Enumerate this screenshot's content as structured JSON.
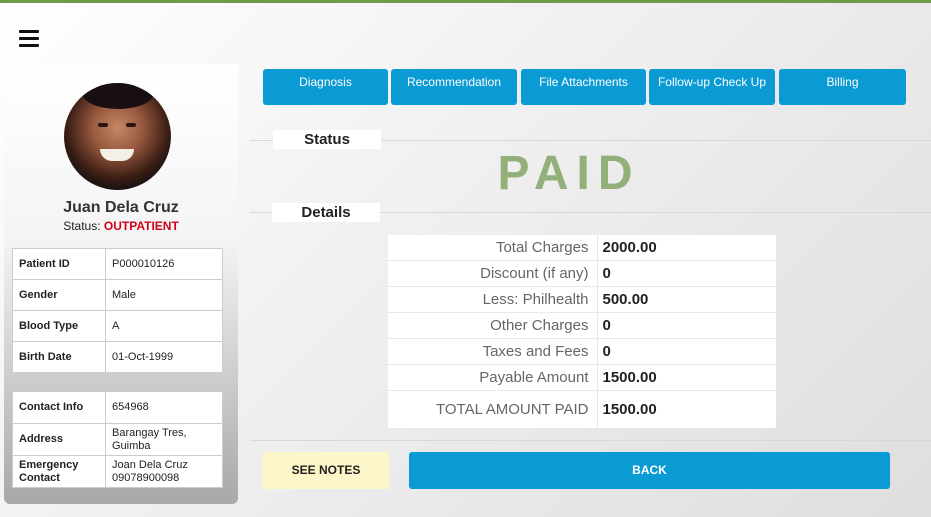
{
  "patient": {
    "name": "Juan Dela Cruz",
    "status_label": "Status:",
    "status_value": "OUTPATIENT"
  },
  "info": [
    {
      "label": "Patient ID",
      "value": "P000010126"
    },
    {
      "label": "Gender",
      "value": "Male"
    },
    {
      "label": "Blood Type",
      "value": "A"
    },
    {
      "label": "Birth Date",
      "value": "01-Oct-1999"
    }
  ],
  "contact": [
    {
      "label": "Contact Info",
      "value": "654968"
    },
    {
      "label": "Address",
      "value": "Barangay Tres, Guimba"
    },
    {
      "label": "Emergency Contact",
      "value": "Joan Dela Cruz 09078900098"
    }
  ],
  "tabs": [
    {
      "label": "Diagnosis"
    },
    {
      "label": "Recommendation"
    },
    {
      "label": "File Attachments"
    },
    {
      "label": "Follow-up Check Up"
    },
    {
      "label": "Billing"
    }
  ],
  "status_section": {
    "label": "Status",
    "value": "PAID"
  },
  "details_section": {
    "label": "Details"
  },
  "billing": [
    {
      "label": "Total Charges",
      "value": "2000.00"
    },
    {
      "label": "Discount (if any)",
      "value": "0"
    },
    {
      "label": "Less: Philhealth",
      "value": "500.00"
    },
    {
      "label": "Other Charges",
      "value": "0"
    },
    {
      "label": "Taxes and Fees",
      "value": "0"
    },
    {
      "label": "Payable Amount",
      "value": "1500.00"
    },
    {
      "label": "TOTAL AMOUNT PAID",
      "value": "1500.00"
    }
  ],
  "actions": {
    "see_notes": "SEE NOTES",
    "back": "BACK"
  },
  "colors": {
    "accent": "#0a9ad4",
    "paid": "#93b07a",
    "status_alert": "#d0021b",
    "notes_bg": "#fdf6c8"
  }
}
